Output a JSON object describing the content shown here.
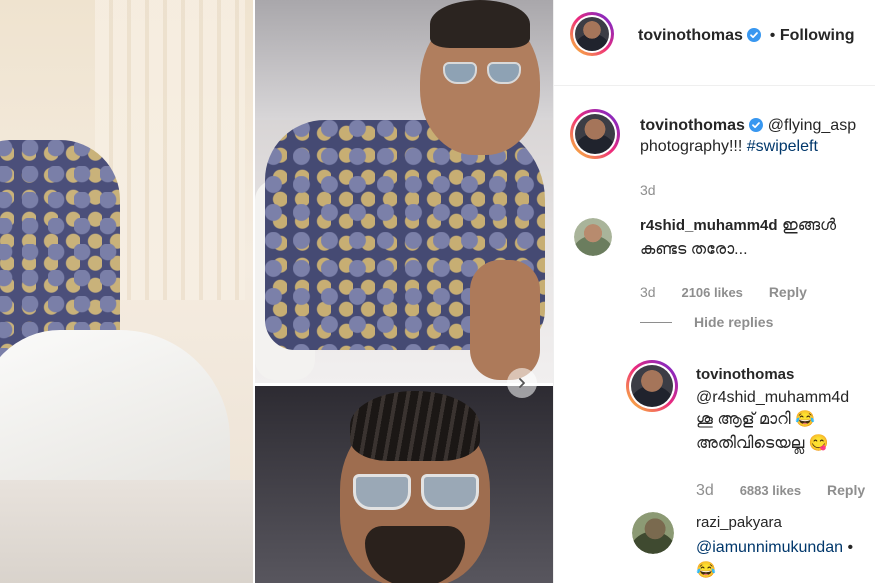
{
  "header": {
    "username": "tovinothomas",
    "separator": "•",
    "follow_status": "Following"
  },
  "caption": {
    "username": "tovinothomas",
    "mention": "@flying_asp",
    "text": "photography!!!",
    "hashtag": "#swipeleft",
    "time": "3d"
  },
  "comments": [
    {
      "username": "r4shid_muhamm4d",
      "line1": "ഇങ്ങൾ",
      "line2": "കണ്ടട തരോ...",
      "time": "3d",
      "likes": "2106 likes",
      "reply_label": "Reply",
      "hide_replies": "Hide replies"
    }
  ],
  "replies": [
    {
      "username": "tovinothomas",
      "mention": "@r4shid_muhamm4d",
      "line1": "ശൂ ആള് മാറി 😂",
      "line2": "അതിവിടെയല്ല 😋",
      "time": "3d",
      "likes": "6883 likes",
      "reply_label": "Reply"
    },
    {
      "username": "razi_pakyara",
      "mention": "@iamunnimukundan",
      "trailing": "•",
      "emoji": "😂"
    }
  ],
  "icons": {
    "verified": "verified-badge-icon",
    "next": "chevron-right-icon"
  },
  "colors": {
    "verified_blue": "#3897f0",
    "link_blue": "#00376b",
    "muted": "#8e8e8e",
    "text": "#262626"
  }
}
